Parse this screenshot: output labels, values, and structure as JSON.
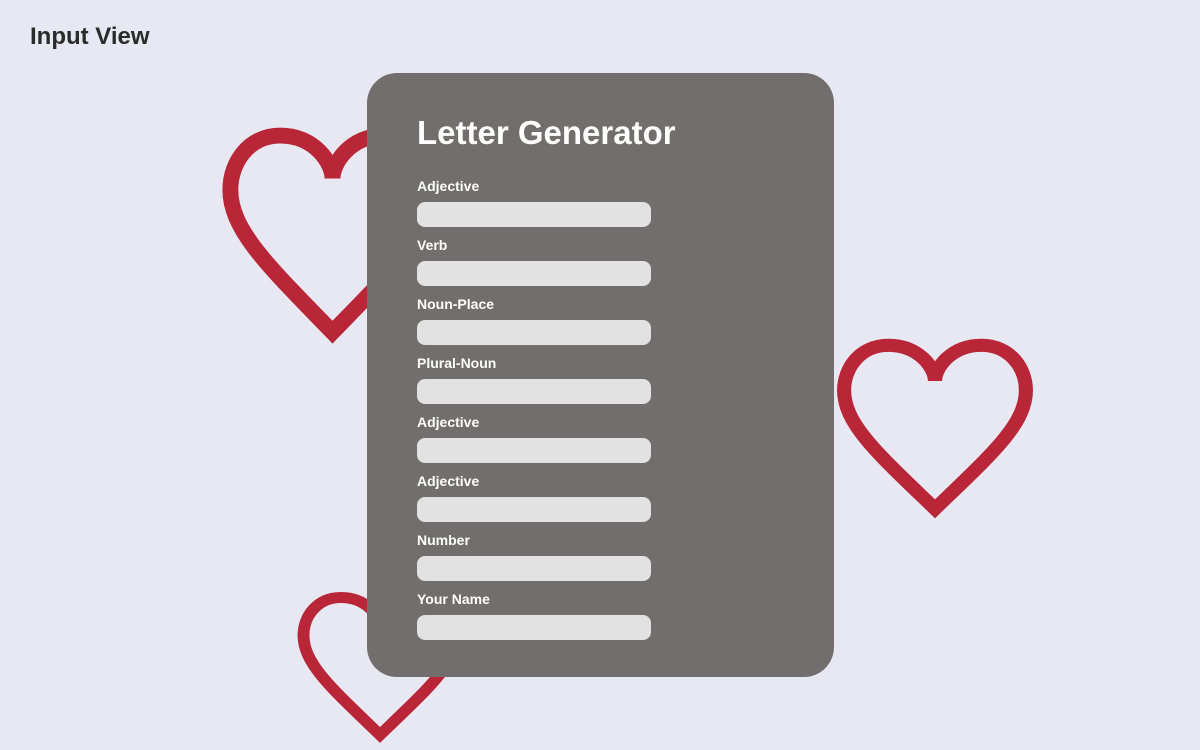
{
  "page": {
    "title": "Input View"
  },
  "decorations": {
    "heart_icon": "heart-outline-icon",
    "heart_color": "#b82637"
  },
  "card": {
    "title": "Letter Generator",
    "background": "#726e6d",
    "fields": [
      {
        "label": "Adjective",
        "value": "",
        "placeholder": ""
      },
      {
        "label": "Verb",
        "value": "",
        "placeholder": ""
      },
      {
        "label": "Noun-Place",
        "value": "",
        "placeholder": ""
      },
      {
        "label": "Plural-Noun",
        "value": "",
        "placeholder": ""
      },
      {
        "label": "Adjective",
        "value": "",
        "placeholder": ""
      },
      {
        "label": "Adjective",
        "value": "",
        "placeholder": ""
      },
      {
        "label": "Number",
        "value": "",
        "placeholder": ""
      },
      {
        "label": "Your Name",
        "value": "",
        "placeholder": ""
      }
    ]
  }
}
